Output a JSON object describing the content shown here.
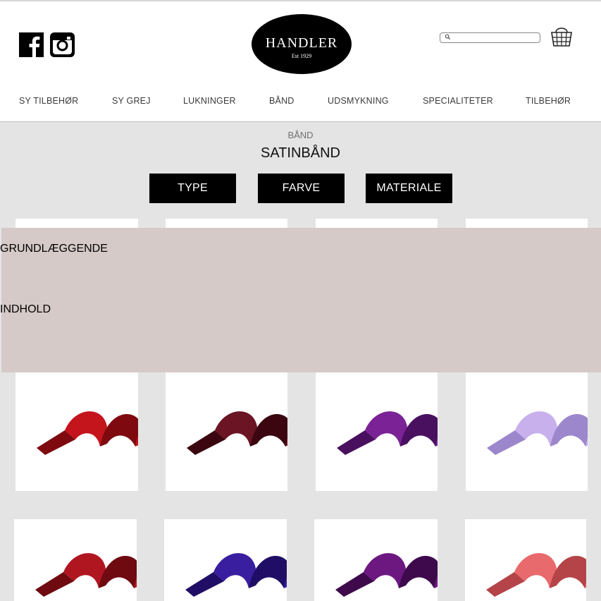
{
  "header": {
    "logo_name": "HANDLER",
    "logo_est": "Est 1929",
    "search_placeholder": ""
  },
  "icons": [
    "facebook-icon",
    "instagram-icon",
    "search-icon",
    "shopping-basket-icon"
  ],
  "nav": {
    "items": [
      {
        "label": "SY TILBEHØR"
      },
      {
        "label": "SY GREJ"
      },
      {
        "label": "LUKNINGER"
      },
      {
        "label": "BÅND"
      },
      {
        "label": "UDSMYKNING"
      },
      {
        "label": "SPECIALITETER"
      },
      {
        "label": "TILBEHØR"
      }
    ]
  },
  "page": {
    "breadcrumb": "BÅND",
    "title": "SATINBÅND"
  },
  "filters": [
    {
      "label": "TYPE"
    },
    {
      "label": "FARVE"
    },
    {
      "label": "MATERIALE"
    }
  ],
  "banner": {
    "line1": "GRUNDLÆGGENDE",
    "line2": "INDHOLD"
  },
  "products": [
    {
      "color": "#c4141c",
      "shade": "#7e0a10"
    },
    {
      "color": "#6a1424",
      "shade": "#3b0610"
    },
    {
      "color": "#7a2296",
      "shade": "#4a1060"
    },
    {
      "color": "#c8b0ec",
      "shade": "#9c86cc"
    },
    {
      "color": "#b01620",
      "shade": "#6e0a10"
    },
    {
      "color": "#3a1ea0",
      "shade": "#200e66"
    },
    {
      "color": "#6c1880",
      "shade": "#3e0a4c"
    },
    {
      "color": "#e86a6c",
      "shade": "#b44448"
    }
  ]
}
